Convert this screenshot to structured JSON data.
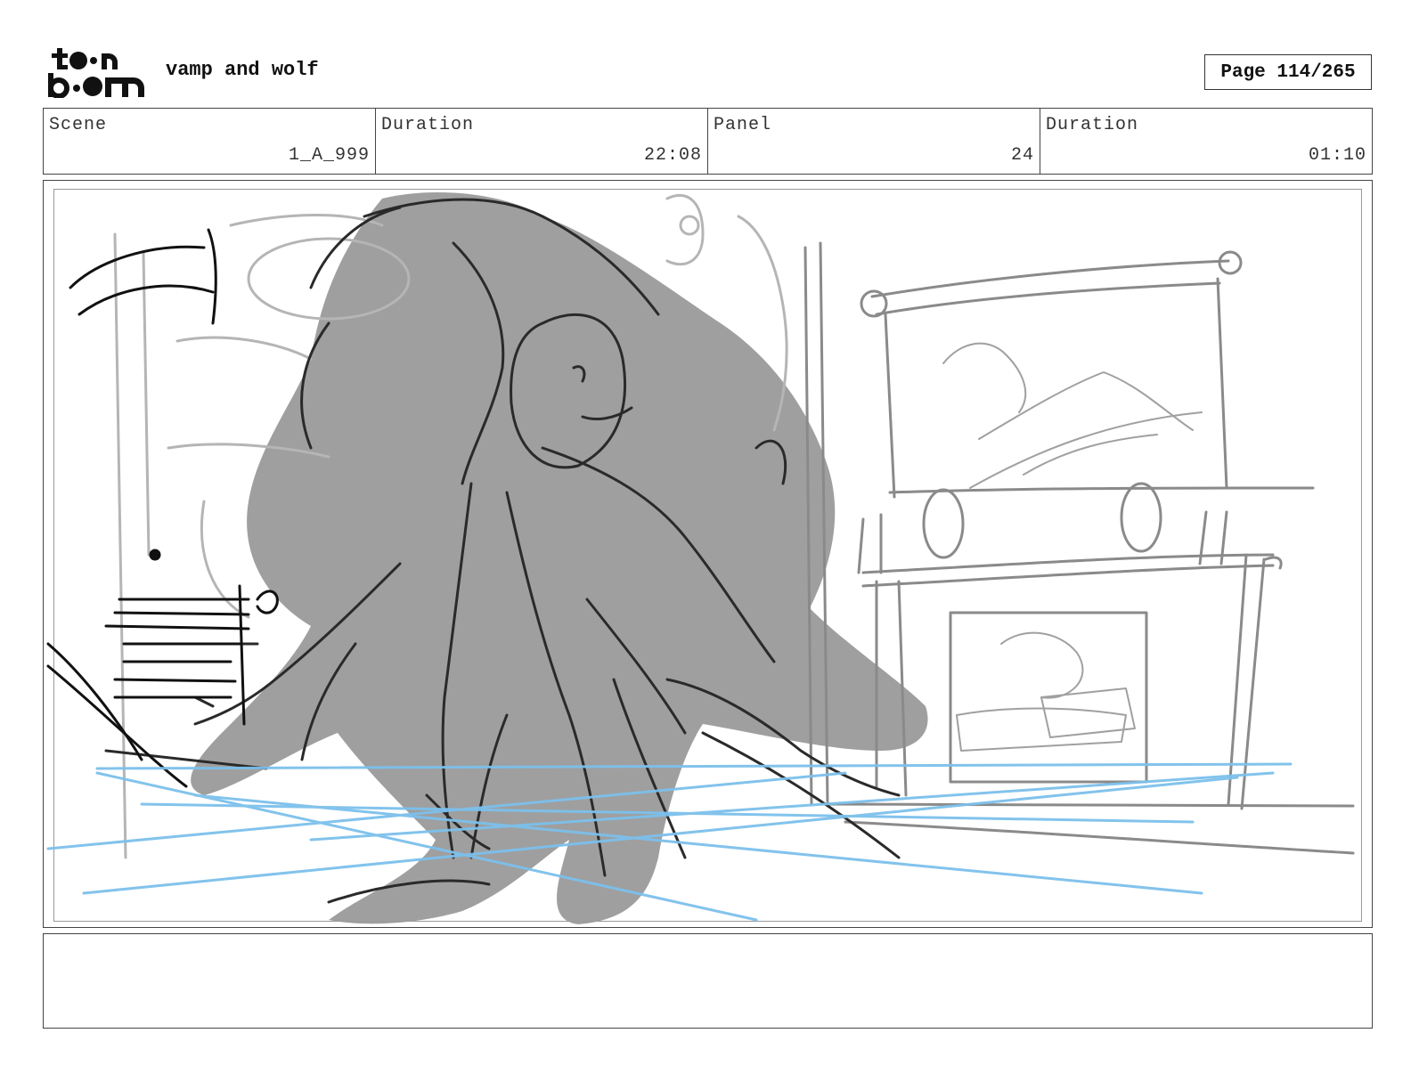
{
  "header": {
    "logo_text": "toon boom",
    "project_title": "vamp and wolf",
    "page_label": "Page 114/265"
  },
  "info": {
    "scene_label": "Scene",
    "scene_value": "1_A_999",
    "scene_duration_label": "Duration",
    "scene_duration_value": "22:08",
    "panel_label": "Panel",
    "panel_value": "24",
    "panel_duration_label": "Duration",
    "panel_duration_value": "01:10"
  },
  "panel": {
    "image_icon": "storyboard-sketch-icon",
    "colors": {
      "sketch_dark": "#2a2a2a",
      "sketch_mid": "#8a8a8a",
      "sketch_light": "#b5b5b5",
      "fill_gray": "#9a9a9a",
      "guide_blue": "#7cc0ec"
    }
  },
  "notes": {
    "text": ""
  }
}
